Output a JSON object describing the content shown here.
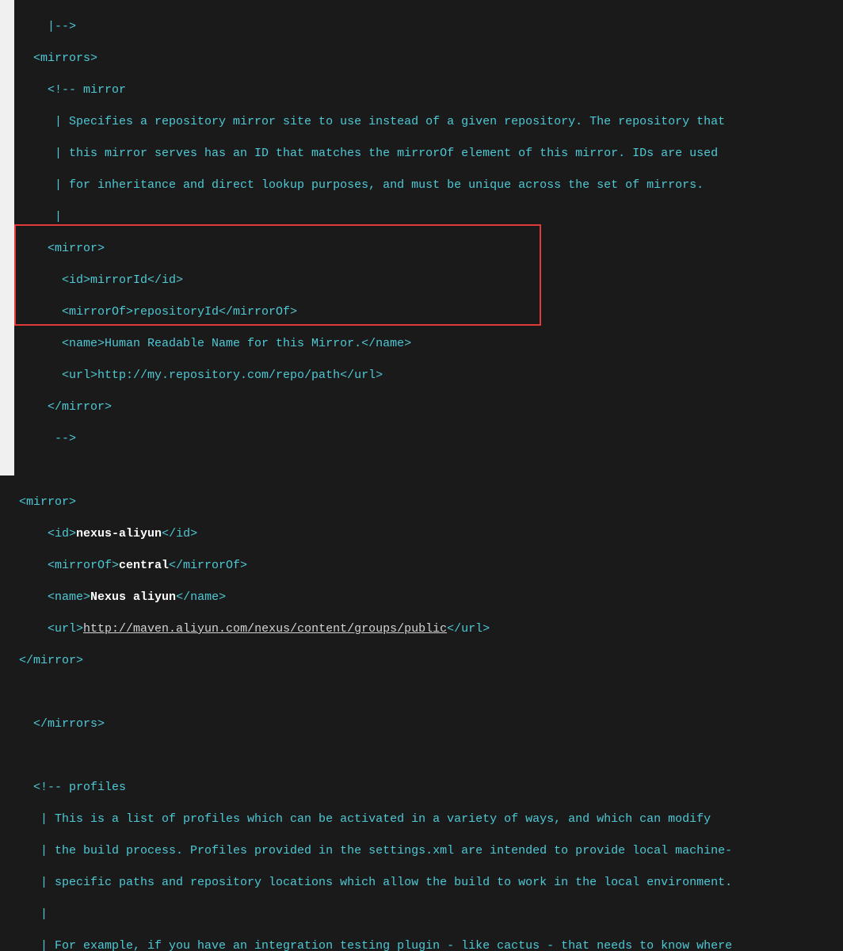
{
  "lines": {
    "l0": "    |-->",
    "l1": "  <mirrors>",
    "l2": "    <!-- mirror",
    "l3": "     | Specifies a repository mirror site to use instead of a given repository. The repository that",
    "l4": "     | this mirror serves has an ID that matches the mirrorOf element of this mirror. IDs are used",
    "l5": "     | for inheritance and direct lookup purposes, and must be unique across the set of mirrors.",
    "l6": "     |",
    "l7": "    <mirror>",
    "l8": "      <id>mirrorId</id>",
    "l9": "      <mirrorOf>repositoryId</mirrorOf>",
    "l10": "      <name>Human Readable Name for this Mirror.</name>",
    "l11": "      <url>http://my.repository.com/repo/path</url>",
    "l12": "    </mirror>",
    "l13": "     -->",
    "l14": "",
    "l21": "",
    "l22": "  </mirrors>",
    "l23": "",
    "l24": "  <!-- profiles",
    "l25": "   | This is a list of profiles which can be activated in a variety of ways, and which can modify",
    "l26": "   | the build process. Profiles provided in the settings.xml are intended to provide local machine-",
    "l27": "   | specific paths and repository locations which allow the build to work in the local environment.",
    "l28": "   |",
    "l29": "   | For example, if you have an integration testing plugin - like cactus - that needs to know where"
  },
  "mirror": {
    "open": "<mirror>",
    "id_open": "<id>",
    "id_val": "nexus-aliyun",
    "id_close": "</id>",
    "of_open": "<mirrorOf>",
    "of_val": "central",
    "of_close": "</mirrorOf>",
    "name_open": "<name>",
    "name_val": "Nexus aliyun",
    "name_close": "</name>",
    "url_open": "<url>",
    "url_val": "http://maven.aliyun.com/nexus/content/groups/public",
    "url_close": "</url>",
    "close": "</mirror>"
  }
}
